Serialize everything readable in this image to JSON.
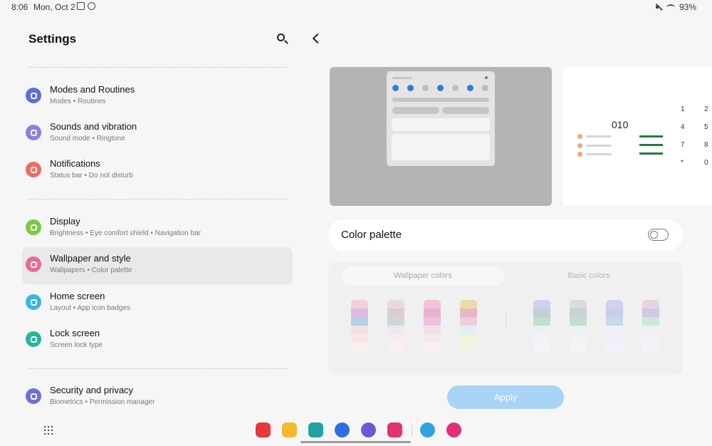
{
  "status_bar": {
    "time": "8:06",
    "date": "Mon, Oct 2",
    "battery": "93%"
  },
  "left_panel": {
    "title": "Settings",
    "items": [
      {
        "label": "Modes and Routines",
        "sub": "Modes • Routines",
        "color": "#5b6fd6"
      },
      {
        "label": "Sounds and vibration",
        "sub": "Sound mode • Ringtone",
        "color": "#8b7fe5"
      },
      {
        "label": "Notifications",
        "sub": "Status bar • Do not disturb",
        "color": "#ef6b63"
      },
      {
        "label": "Display",
        "sub": "Brightness • Eye comfort shield • Navigation bar",
        "color": "#7ac943"
      },
      {
        "label": "Wallpaper and style",
        "sub": "Wallpapers • Color palette",
        "color": "#ec6a91",
        "selected": true
      },
      {
        "label": "Home screen",
        "sub": "Layout • App icon badges",
        "color": "#38b6e6"
      },
      {
        "label": "Lock screen",
        "sub": "Screen lock type",
        "color": "#28b39a"
      },
      {
        "label": "Security and privacy",
        "sub": "Biometrics • Permission manager",
        "color": "#6f6fdc"
      }
    ]
  },
  "right_panel": {
    "phone_number": "010",
    "dialpad": [
      "1",
      "2",
      "4",
      "5",
      "7",
      "8",
      "*",
      "0"
    ],
    "color_palette_label": "Color palette",
    "color_palette_enabled": false,
    "tabs": {
      "wallpaper": "Wallpaper colors",
      "basic": "Basic colors"
    },
    "apply_label": "Apply"
  }
}
